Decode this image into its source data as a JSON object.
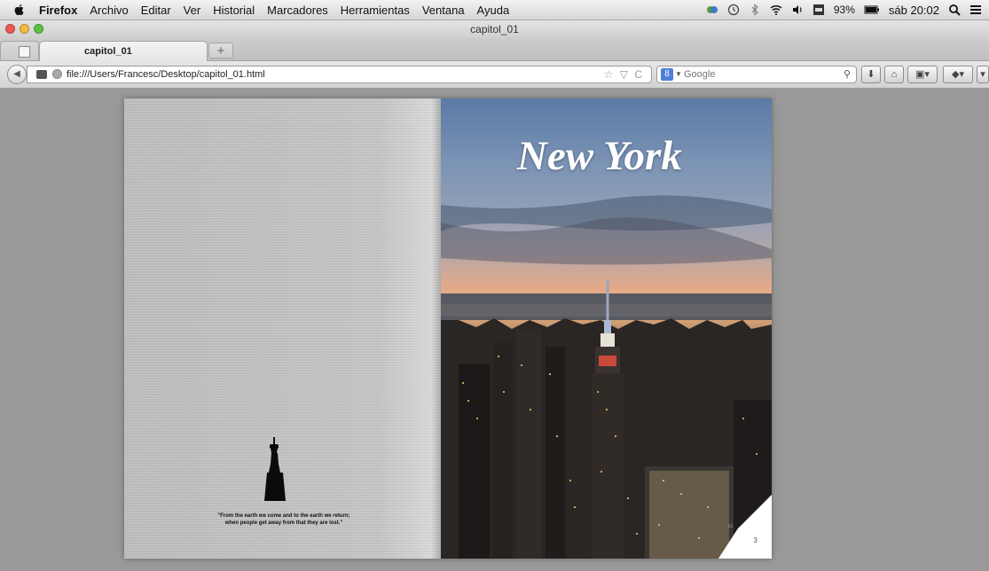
{
  "menubar": {
    "app_name": "Firefox",
    "items": [
      "Archivo",
      "Editar",
      "Ver",
      "Historial",
      "Marcadores",
      "Herramientas",
      "Ventana",
      "Ayuda"
    ],
    "battery": "93%",
    "clock": "sáb 20:02"
  },
  "window": {
    "title": "capitol_01"
  },
  "tabs": {
    "active_label": "capitol_01",
    "new_tab_label": "+"
  },
  "navbar": {
    "url": "file:///Users/Francesc/Desktop/capitol_01.html",
    "url_actions": "☆ ▽ C",
    "search_placeholder": "Google",
    "search_engine_badge": "8"
  },
  "document": {
    "title": "New York",
    "quote_line1": "\"From the earth we come and to the earth we return;",
    "quote_line2": "when people get away from that they are lost.\"",
    "page_number": "3",
    "page_curl_label": "s3"
  },
  "colors": {
    "background": "#999999",
    "title_text": "#ffffff"
  }
}
